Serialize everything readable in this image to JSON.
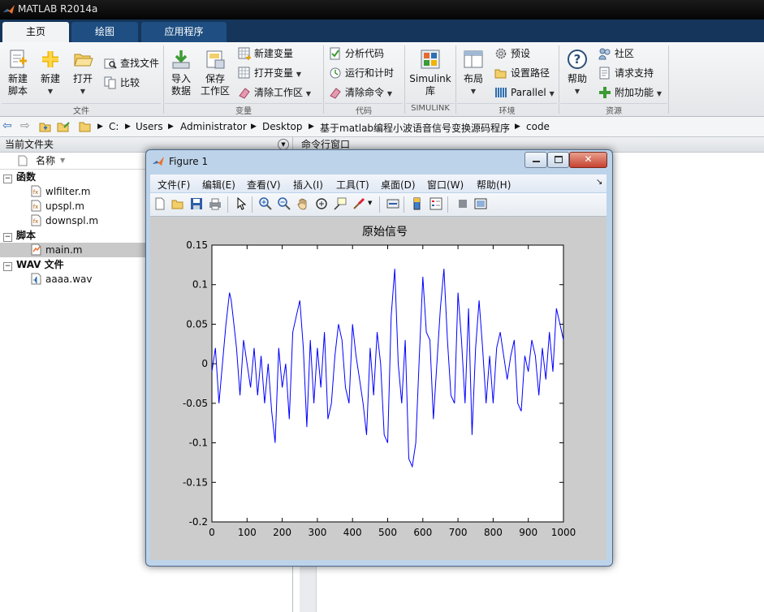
{
  "window": {
    "title": "MATLAB R2014a"
  },
  "tabs": [
    {
      "label": "主页",
      "active": true
    },
    {
      "label": "绘图",
      "active": false
    },
    {
      "label": "应用程序",
      "active": false
    }
  ],
  "toolstrip": {
    "file": {
      "label": "文件",
      "new_script": "新建\n脚本",
      "new": "新建",
      "open": "打开",
      "find_files": "查找文件",
      "compare": "比较"
    },
    "variable": {
      "label": "变量",
      "import": "导入\n数据",
      "save": "保存\n工作区",
      "new_var": "新建变量",
      "open_var": "打开变量",
      "clear_ws": "清除工作区"
    },
    "code": {
      "label": "代码",
      "analyze": "分析代码",
      "run_time": "运行和计时",
      "clear_cmd": "清除命令"
    },
    "simulink": {
      "label": "SIMULINK",
      "lib": "Simulink\n库"
    },
    "env": {
      "label": "环境",
      "layout": "布局",
      "prefs": "预设",
      "set_path": "设置路径",
      "parallel": "Parallel"
    },
    "resources": {
      "label": "资源",
      "help": "帮助",
      "community": "社区",
      "support": "请求支持",
      "addons": "附加功能"
    }
  },
  "address": {
    "crumbs": [
      "C:",
      "Users",
      "Administrator",
      "Desktop",
      "基于matlab编程小波语音信号变换源码程序",
      "code"
    ]
  },
  "current_folder": {
    "title": "当前文件夹",
    "col_name": "名称",
    "groups": [
      {
        "name": "函数",
        "files": [
          "wlfilter.m",
          "upspl.m",
          "downspl.m"
        ]
      },
      {
        "name": "脚本",
        "files": [
          "main.m"
        ]
      },
      {
        "name": "WAV 文件",
        "files": [
          "aaaa.wav"
        ]
      }
    ],
    "selected_file": "main.m"
  },
  "command_window": {
    "title": "命令行窗口"
  },
  "figure": {
    "title": "Figure 1",
    "menu": [
      "文件(F)",
      "编辑(E)",
      "查看(V)",
      "插入(I)",
      "工具(T)",
      "桌面(D)",
      "窗口(W)",
      "帮助(H)"
    ]
  },
  "chart_data": {
    "type": "line",
    "title": "原始信号",
    "xlabel": "",
    "ylabel": "",
    "xlim": [
      0,
      1000
    ],
    "ylim": [
      -0.2,
      0.15
    ],
    "xticks": [
      0,
      100,
      200,
      300,
      400,
      500,
      600,
      700,
      800,
      900,
      1000
    ],
    "yticks": [
      0.15,
      0.1,
      0.05,
      0,
      -0.05,
      -0.1,
      -0.15,
      -0.2
    ],
    "series": [
      {
        "color": "#0000ff",
        "x": [
          0,
          10,
          20,
          30,
          40,
          50,
          55,
          60,
          70,
          80,
          90,
          100,
          110,
          120,
          130,
          140,
          150,
          160,
          170,
          180,
          190,
          200,
          210,
          220,
          230,
          240,
          250,
          260,
          270,
          280,
          290,
          300,
          310,
          320,
          330,
          340,
          350,
          360,
          370,
          380,
          390,
          400,
          410,
          420,
          430,
          440,
          450,
          460,
          470,
          480,
          490,
          500,
          510,
          520,
          530,
          540,
          550,
          560,
          570,
          580,
          590,
          600,
          610,
          620,
          630,
          640,
          650,
          660,
          670,
          680,
          690,
          700,
          710,
          720,
          730,
          740,
          750,
          760,
          770,
          780,
          790,
          800,
          810,
          820,
          830,
          840,
          850,
          860,
          870,
          880,
          890,
          900,
          910,
          920,
          930,
          940,
          950,
          960,
          970,
          980,
          990,
          1000
        ],
        "y": [
          -0.01,
          0.02,
          -0.05,
          0.0,
          0.05,
          0.09,
          0.08,
          0.06,
          0.02,
          -0.04,
          0.03,
          0.0,
          -0.03,
          0.02,
          -0.04,
          0.01,
          -0.05,
          0.0,
          -0.06,
          -0.1,
          0.02,
          -0.03,
          0.0,
          -0.07,
          0.04,
          0.06,
          0.08,
          0.02,
          -0.08,
          0.03,
          -0.05,
          0.02,
          -0.03,
          0.04,
          -0.07,
          -0.05,
          0.01,
          0.05,
          0.03,
          -0.03,
          -0.05,
          0.05,
          0.01,
          -0.02,
          -0.05,
          -0.09,
          0.02,
          -0.04,
          0.04,
          0.0,
          -0.09,
          -0.1,
          0.06,
          0.12,
          0.0,
          -0.05,
          0.03,
          -0.12,
          -0.13,
          -0.1,
          0.01,
          0.11,
          0.04,
          0.03,
          -0.07,
          0.0,
          0.07,
          0.12,
          0.03,
          -0.04,
          -0.05,
          0.09,
          0.03,
          -0.05,
          0.07,
          -0.09,
          0.02,
          0.08,
          0.02,
          -0.05,
          0.01,
          -0.05,
          0.02,
          0.04,
          0.01,
          -0.02,
          0.01,
          0.03,
          -0.05,
          -0.06,
          0.01,
          -0.01,
          0.03,
          0.01,
          -0.04,
          0.02,
          -0.02,
          0.04,
          -0.01,
          0.07,
          0.05,
          0.03
        ]
      }
    ],
    "grid": false
  }
}
